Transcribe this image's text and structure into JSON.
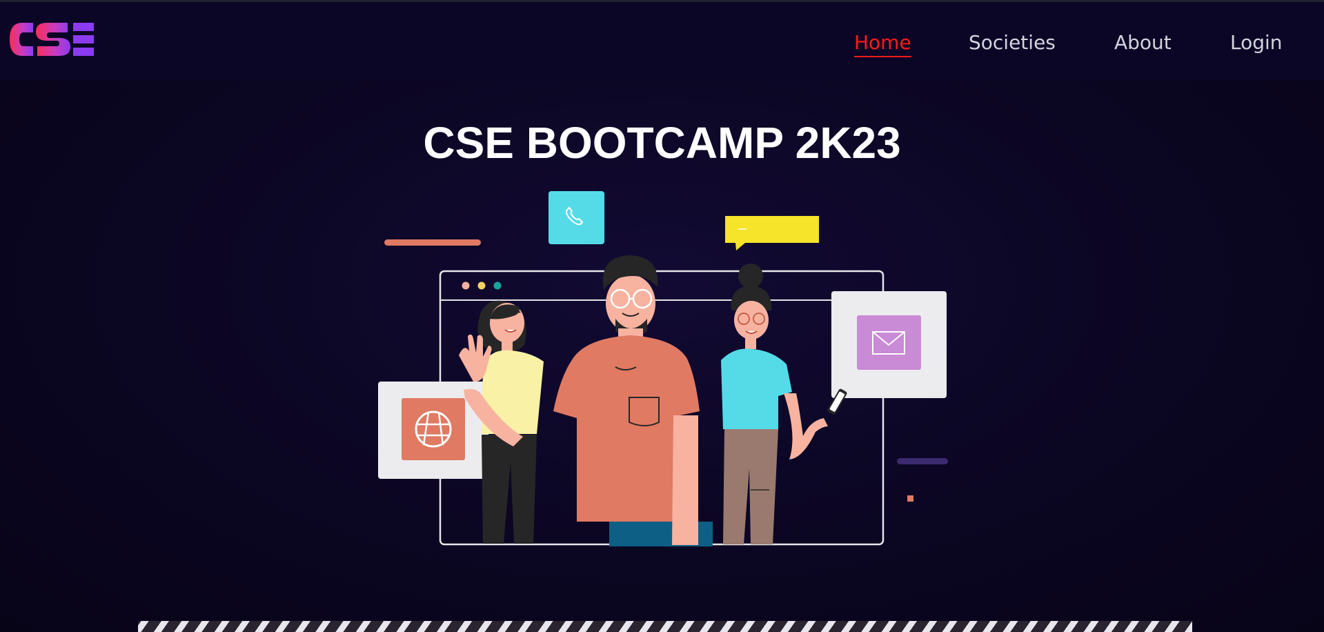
{
  "nav": {
    "brand": "CSE",
    "links": [
      {
        "label": "Home",
        "active": true
      },
      {
        "label": "Societies",
        "active": false
      },
      {
        "label": "About",
        "active": false
      },
      {
        "label": "Login",
        "active": false
      }
    ]
  },
  "hero": {
    "title": "CSE BOOTCAMP 2K23",
    "illustration_icons": [
      "phone-icon",
      "chat-bubble-icon",
      "mail-icon",
      "globe-icon",
      "smartphone-icon"
    ]
  },
  "colors": {
    "background": "#0b0622",
    "active_link": "#ff1a1a",
    "nav_text": "#d4d4de",
    "title_text": "#ffffff"
  }
}
